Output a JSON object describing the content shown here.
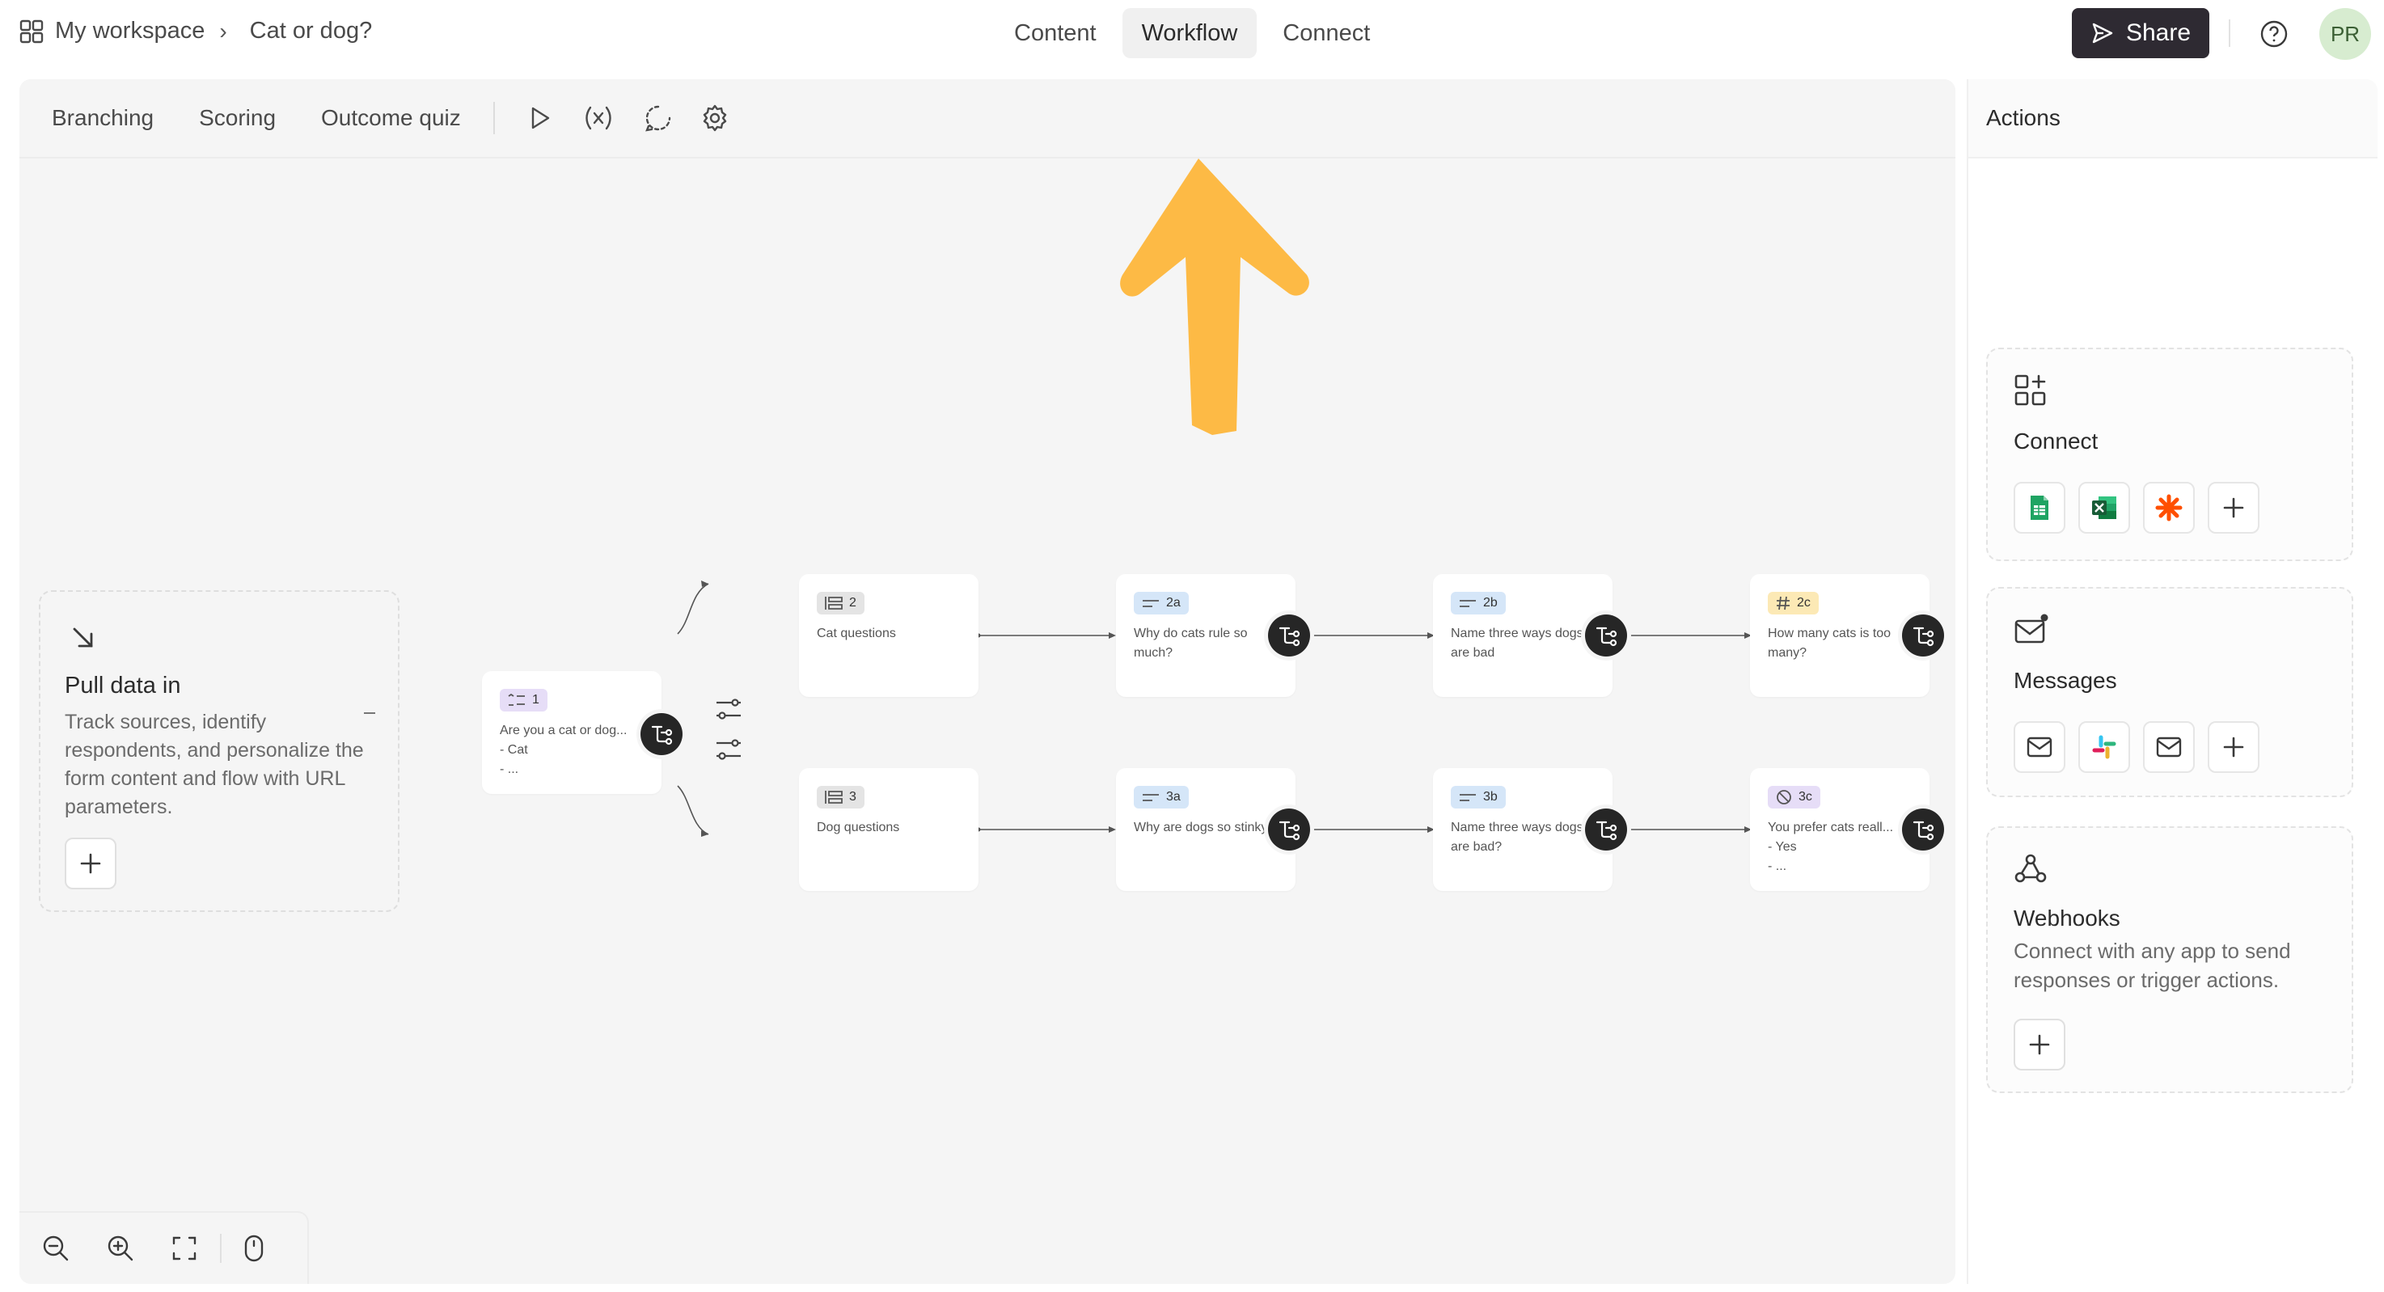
{
  "breadcrumb": {
    "workspace": "My workspace",
    "separator": "›",
    "form": "Cat or dog?"
  },
  "tabs": [
    {
      "label": "Content",
      "active": false
    },
    {
      "label": "Workflow",
      "active": true
    },
    {
      "label": "Connect",
      "active": false
    }
  ],
  "share": {
    "label": "Share"
  },
  "avatar": {
    "initials": "PR"
  },
  "canvas_toolbar": {
    "tabs": [
      "Branching",
      "Scoring",
      "Outcome quiz"
    ]
  },
  "pull_data": {
    "title": "Pull data in",
    "description": "Track sources, identify respondents, and personalize the form content and flow with URL parameters."
  },
  "nodes": {
    "n1": {
      "badge": "1",
      "text": "Are you a cat or dog...\n- Cat\n- ..."
    },
    "n2": {
      "badge": "2",
      "text": "Cat questions"
    },
    "n2a": {
      "badge": "2a",
      "text": "Why do cats rule so much?"
    },
    "n2b": {
      "badge": "2b",
      "text": "Name three ways dogs are bad"
    },
    "n2c": {
      "badge": "2c",
      "text": "How many cats is too many?"
    },
    "n3": {
      "badge": "3",
      "text": "Dog questions"
    },
    "n3a": {
      "badge": "3a",
      "text": "Why are dogs so stinky?"
    },
    "n3b": {
      "badge": "3b",
      "text": "Name three ways dogs are bad?"
    },
    "n3c": {
      "badge": "3c",
      "text": "You prefer cats reall...\n- Yes\n- ..."
    }
  },
  "actions": {
    "title": "Actions",
    "connect": {
      "title": "Connect"
    },
    "messages": {
      "title": "Messages"
    },
    "webhooks": {
      "title": "Webhooks",
      "description": "Connect with any app to send responses or trigger actions."
    }
  },
  "colors": {
    "accent_arrow": "#FDBA45",
    "share_bg": "#2E2A32",
    "badge_purple": "#E6DDF7",
    "badge_gray": "#E4E4E4",
    "badge_blue": "#D5E6F8",
    "badge_yellow": "#FCE9B5",
    "avatar_bg": "#D7ECD0"
  }
}
